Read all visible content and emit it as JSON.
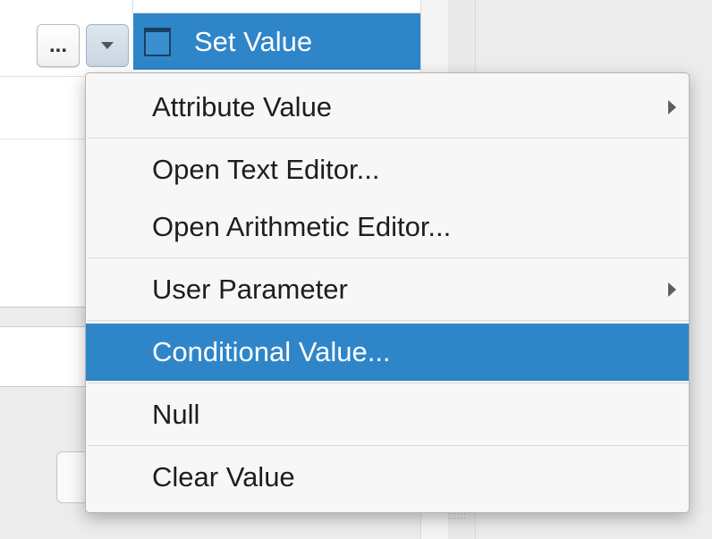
{
  "cell": {
    "more_label": "...",
    "dropdown_icon": "triangle-down-icon",
    "set_value_label": "Set Value",
    "field_icon": "field-icon"
  },
  "menu": {
    "items": [
      {
        "label": "Attribute Value",
        "submenu": true
      },
      {
        "label": "Open Text Editor...",
        "submenu": false
      },
      {
        "label": "Open Arithmetic Editor...",
        "submenu": false
      },
      {
        "label": "User Parameter",
        "submenu": true
      },
      {
        "label": "Conditional Value...",
        "submenu": false,
        "highlighted": true
      },
      {
        "label": "Null",
        "submenu": false
      },
      {
        "label": "Clear Value",
        "submenu": false
      }
    ]
  },
  "colors": {
    "highlight": "#2e86c9",
    "menu_background": "#f7f7f7",
    "text": "#1e1e1e"
  }
}
